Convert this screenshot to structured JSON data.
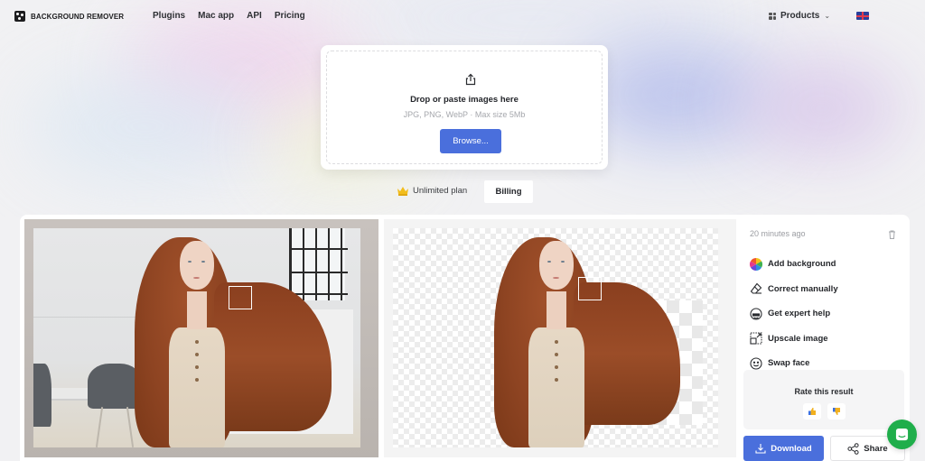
{
  "header": {
    "brand": "BACKGROUND REMOVER",
    "nav": [
      {
        "label": "Plugins"
      },
      {
        "label": "Mac app"
      },
      {
        "label": "API"
      },
      {
        "label": "Pricing"
      }
    ],
    "products_label": "Products",
    "language_flag": "uk-flag-icon"
  },
  "upload": {
    "icon": "share-upload-icon",
    "title": "Drop or paste images here",
    "subtitle": "JPG, PNG, WebP · Max size 5Mb",
    "browse_label": "Browse..."
  },
  "plan": {
    "icon": "crown-icon",
    "label": "Unlimited plan",
    "billing_label": "Billing"
  },
  "result": {
    "original_image_alt": "Original photo: girl with long red hair in a room",
    "processed_image_alt": "Background removed: girl with long red hair on transparent background",
    "timestamp": "20 minutes ago",
    "actions": [
      {
        "icon": "color-wheel-icon",
        "label": "Add background"
      },
      {
        "icon": "eraser-icon",
        "label": "Correct manually"
      },
      {
        "icon": "expert-icon",
        "label": "Get expert help"
      },
      {
        "icon": "upscale-icon",
        "label": "Upscale image"
      },
      {
        "icon": "smiley-icon",
        "label": "Swap face"
      }
    ],
    "rate_title": "Rate this result",
    "download_label": "Download",
    "share_label": "Share"
  },
  "colors": {
    "primary": "#4a6fdc",
    "chat": "#1fae4b",
    "text": "#25272b",
    "muted": "#9a9ca1"
  }
}
